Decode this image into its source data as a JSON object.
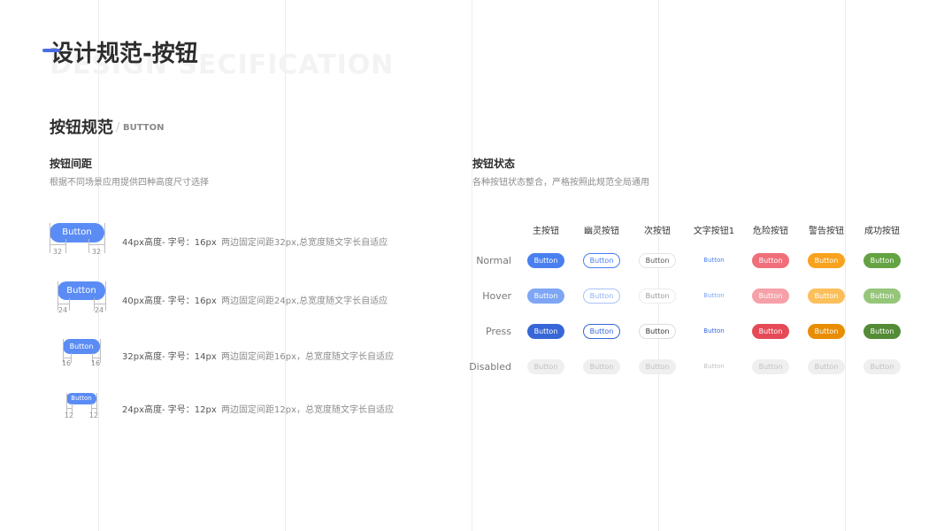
{
  "header": {
    "title": "设计规范-按钮",
    "title_en": "DESIGN SECIFICATION"
  },
  "section": {
    "title": "按钮规范",
    "separator": "/",
    "title_en": "BUTTON"
  },
  "spacing": {
    "title": "按钮间距",
    "desc": "根据不同场景应用提供四种高度尺寸选择",
    "items": [
      {
        "button_label": "Button",
        "left": "32",
        "right": "32",
        "spec": "44px高度- 字号：16px",
        "desc": "两边固定间距32px,总宽度随文字长自适应"
      },
      {
        "button_label": "Button",
        "left": "24",
        "right": "24",
        "spec": "40px高度- 字号：16px",
        "desc": "两边固定间距24px,总宽度随文字长自适应"
      },
      {
        "button_label": "Button",
        "left": "16",
        "right": "16",
        "spec": "32px高度- 字号：14px",
        "desc": "两边固定间距16px，总宽度随文字长自适应"
      },
      {
        "button_label": "Button",
        "left": "12",
        "right": "12",
        "spec": "24px高度- 字号：12px",
        "desc": "两边固定间距12px，总宽度随文字长自适应"
      }
    ]
  },
  "states": {
    "title": "按钮状态",
    "desc": "各种按钮状态整合，严格按照此规范全局通用",
    "columns": [
      "主按钮",
      "幽灵按钮",
      "次按钮",
      "文字按钮1",
      "危险按钮",
      "警告按钮",
      "成功按钮"
    ],
    "rows": [
      "Normal",
      "Hover",
      "Press",
      "Disabled"
    ],
    "button_label": "Button",
    "colors": {
      "primary_normal": "#4a7ff0",
      "primary_hover": "#7ea6f5",
      "primary_press": "#3766d6",
      "danger_normal": "#f06f7a",
      "danger_hover": "#f6a0a8",
      "danger_press": "#e54a57",
      "warning_normal": "#f8a21d",
      "warning_hover": "#fbbf5b",
      "warning_press": "#e98d05",
      "success_normal": "#63a342",
      "success_hover": "#95c67a",
      "success_press": "#538b36",
      "disabled_bg": "#efefef",
      "disabled_text": "#c2c2c2"
    }
  }
}
